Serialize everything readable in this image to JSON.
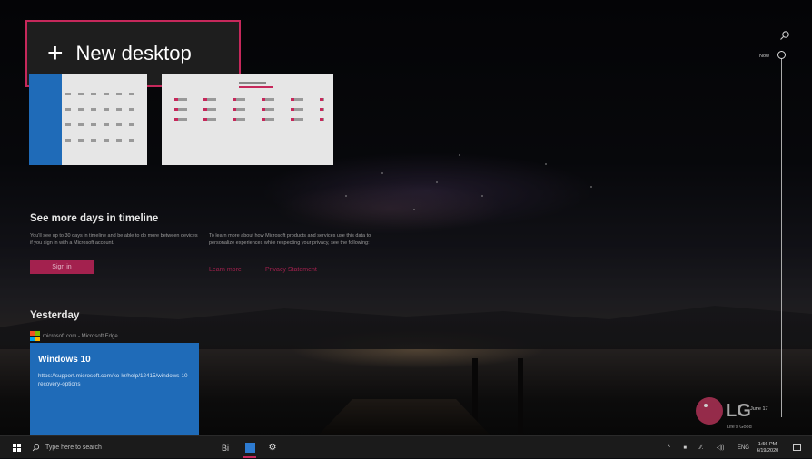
{
  "new_desktop": {
    "plus": "+",
    "label": "New desktop"
  },
  "timeline": {
    "more_days_title": "See more days in timeline",
    "more_days_text": "You'll see up to 30 days in timeline and be able to do more between devices if you sign in with a Microsoft account.",
    "privacy_text": "To learn more about how Microsoft products and services use this data to personalize experiences while respecting your privacy, see the following:",
    "sign_in_label": "Sign in",
    "learn_more_label": "Learn more",
    "privacy_label": "Privacy Statement",
    "yesterday_label": "Yesterday",
    "activity": {
      "source": "microsoft.com - Microsoft Edge",
      "title": "Windows 10",
      "url": "https://support.microsoft.com/ko-kr/help/12415/windows-10-recovery-options"
    },
    "now_label": "Now",
    "date_label": "June 17"
  },
  "brand": {
    "logo_text": "LG",
    "tagline": "Life's Good"
  },
  "taskbar": {
    "search_placeholder": "Type here to search",
    "task_view_label": "Bi",
    "tray_items": [
      "^",
      "■",
      "∕∕.",
      "◁))",
      "ENG"
    ],
    "time": "1:56 PM",
    "date": "6/19/2020"
  },
  "colors": {
    "accent": "#c6285b",
    "tile_blue": "#1f6bb8",
    "taskbar": "#1b1b1b"
  }
}
